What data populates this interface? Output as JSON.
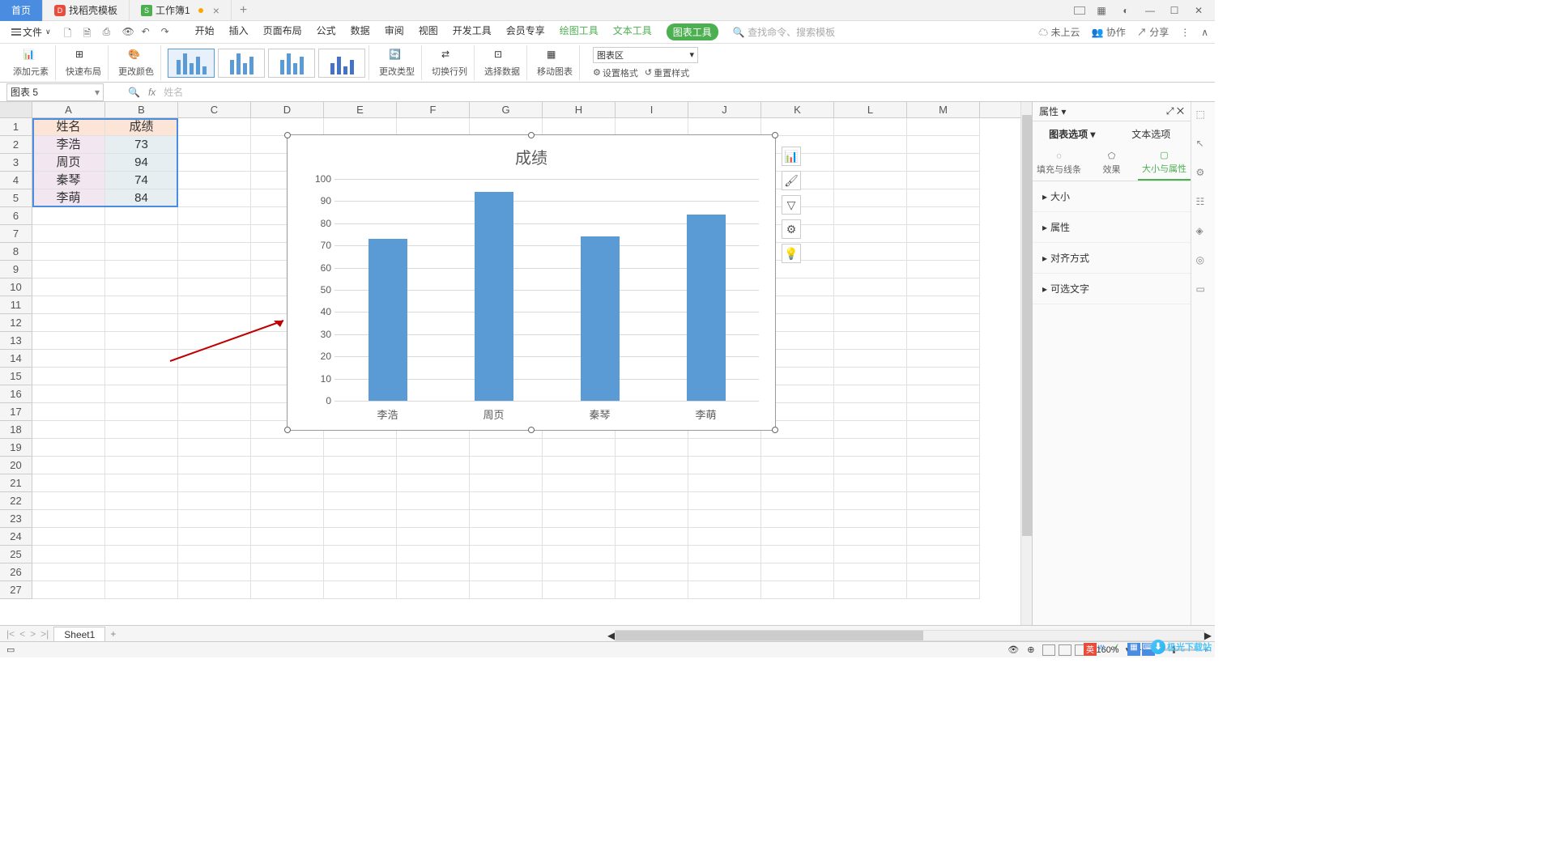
{
  "tabs": {
    "home": "首页",
    "t1": "找稻壳模板",
    "t2": "工作簿1"
  },
  "menu": {
    "file": "文件",
    "items": [
      "开始",
      "插入",
      "页面布局",
      "公式",
      "数据",
      "审阅",
      "视图",
      "开发工具",
      "会员专享"
    ],
    "drawTool": "绘图工具",
    "textTool": "文本工具",
    "chartTool": "图表工具",
    "search": "查找命令、搜索模板"
  },
  "rightTools": {
    "cloud": "未上云",
    "coop": "协作",
    "share": "分享"
  },
  "ribbon": {
    "addElem": "添加元素",
    "quickLayout": "快速布局",
    "changeColor": "更改颜色",
    "changeType": "更改类型",
    "swapRC": "切换行列",
    "selData": "选择数据",
    "moveChart": "移动图表",
    "chartArea": "图表区",
    "setFormat": "设置格式",
    "resetStyle": "重置样式"
  },
  "nameBox": "图表 5",
  "formulaHint": "姓名",
  "columns": [
    "A",
    "B",
    "C",
    "D",
    "E",
    "F",
    "G",
    "H",
    "I",
    "J",
    "K",
    "L",
    "M"
  ],
  "rows": 27,
  "table": {
    "headers": [
      "姓名",
      "成绩"
    ],
    "rows": [
      {
        "name": "李浩",
        "score": "73"
      },
      {
        "name": "周页",
        "score": "94"
      },
      {
        "name": "秦琴",
        "score": "74"
      },
      {
        "name": "李萌",
        "score": "84"
      }
    ]
  },
  "chart_data": {
    "type": "bar",
    "title": "成绩",
    "categories": [
      "李浩",
      "周页",
      "秦琴",
      "李萌"
    ],
    "values": [
      73,
      94,
      74,
      84
    ],
    "ylim": [
      0,
      100
    ],
    "yticks": [
      0,
      10,
      20,
      30,
      40,
      50,
      60,
      70,
      80,
      90,
      100
    ],
    "xlabel": "",
    "ylabel": ""
  },
  "rightPanel": {
    "title": "属性",
    "tab1": "图表选项",
    "tab2": "文本选项",
    "sub1": "填充与线条",
    "sub2": "效果",
    "sub3": "大小与属性",
    "sections": [
      "大小",
      "属性",
      "对齐方式",
      "可选文字"
    ]
  },
  "sheet": "Sheet1",
  "zoom": "160%",
  "watermark": "极光下载站"
}
